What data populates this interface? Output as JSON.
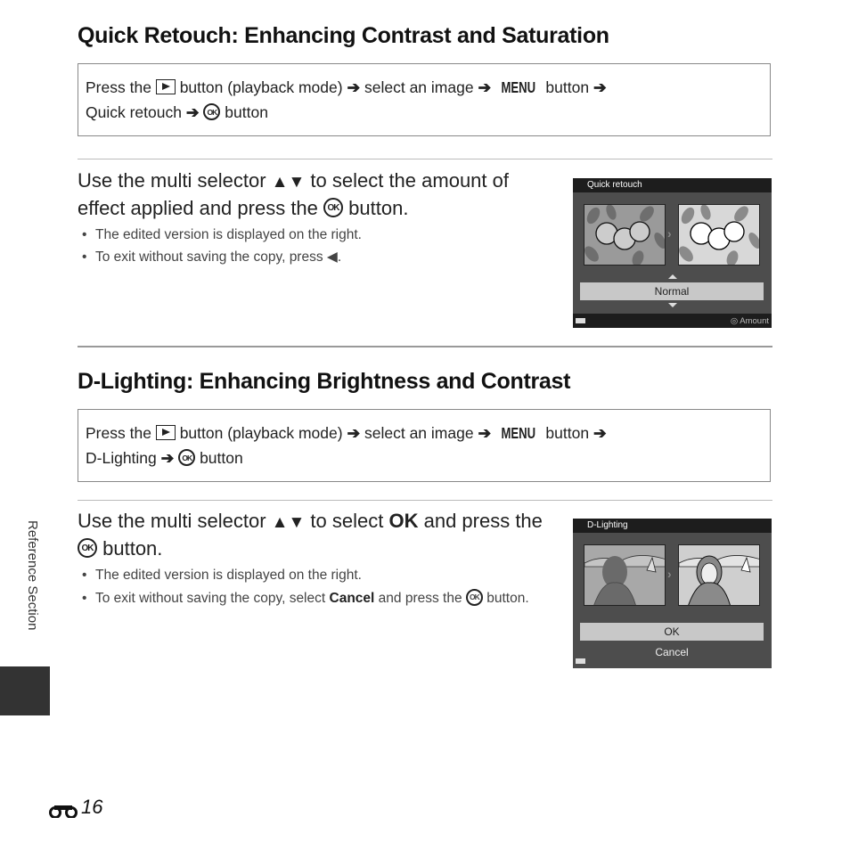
{
  "section1": {
    "title": "Quick Retouch: Enhancing Contrast and Saturation",
    "path": {
      "line1_a": "Press the",
      "play_icon": "playback-button-icon",
      "line1_b": "button (playback mode)",
      "arrow": "➔",
      "line1_c": "select an image",
      "menu": "MENU",
      "line1_d": "button",
      "line2_a": "Quick retouch",
      "ok": "OK",
      "line2_b": "button"
    },
    "step": {
      "text_a": "Use the multi selector",
      "tri": "▲▼",
      "text_b": "to select the amount of effect applied and press the",
      "ok": "OK",
      "text_c": "button."
    },
    "bullets": [
      {
        "text": "The edited version is displayed on the right."
      },
      {
        "text_a": "To exit without saving the copy, press",
        "glyph": "◀",
        "text_b": "."
      }
    ],
    "screen": {
      "title": "Quick retouch",
      "selected": "Normal",
      "footer_hint": "Amount"
    }
  },
  "section2": {
    "title": "D-Lighting: Enhancing Brightness and Contrast",
    "path": {
      "line1_a": "Press the",
      "line1_b": "button (playback mode)",
      "arrow": "➔",
      "line1_c": "select an image",
      "menu": "MENU",
      "line1_d": "button",
      "line2_a": "D-Lighting",
      "ok": "OK",
      "line2_b": "button"
    },
    "step": {
      "text_a": "Use the multi selector",
      "tri": "▲▼",
      "text_b": "to select",
      "bold": "OK",
      "text_c": "and press the",
      "ok": "OK",
      "text_d": "button."
    },
    "bullets": [
      {
        "text": "The edited version is displayed on the right."
      },
      {
        "text_a": "To exit without saving the copy, select",
        "bold": "Cancel",
        "text_b": "and press the",
        "ok": "OK",
        "text_c": "button."
      }
    ],
    "screen": {
      "title": "D-Lighting",
      "options": [
        "OK",
        "Cancel"
      ],
      "selected": "OK"
    }
  },
  "sidebar": {
    "label": "Reference Section"
  },
  "footer": {
    "page_icon": "binoculars-icon",
    "page_number": "16"
  },
  "bullet_char": "•"
}
